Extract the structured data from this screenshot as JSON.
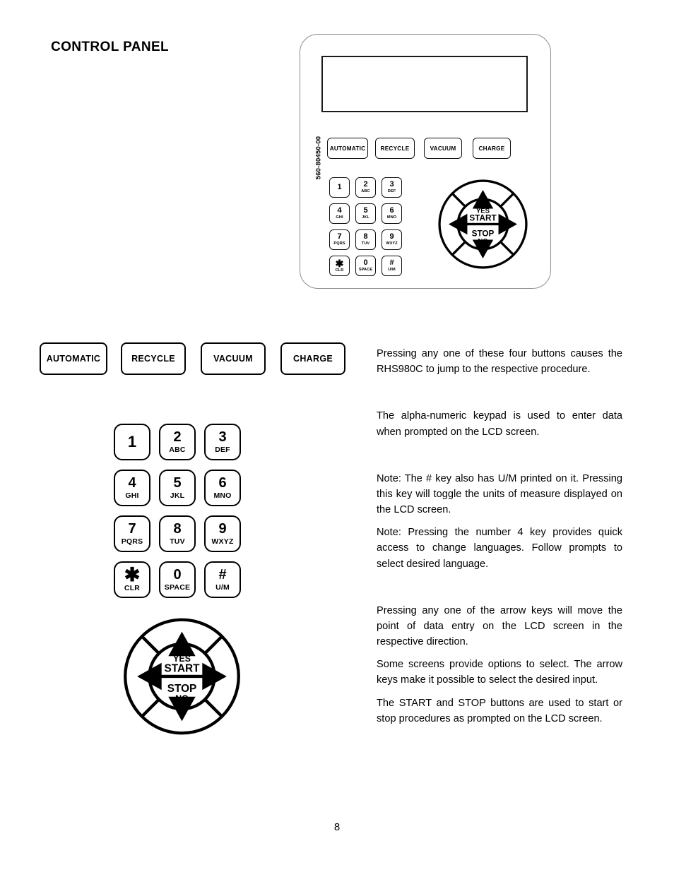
{
  "page": {
    "title": "CONTROL PANEL",
    "number": "8"
  },
  "panel": {
    "part_number": "560-80450-00",
    "lcd_label": "",
    "function_buttons": [
      {
        "label": "AUTOMATIC"
      },
      {
        "label": "RECYCLE"
      },
      {
        "label": "VACUUM"
      },
      {
        "label": "CHARGE"
      }
    ],
    "keypad": [
      {
        "digit": "1",
        "sub": ""
      },
      {
        "digit": "2",
        "sub": "ABC"
      },
      {
        "digit": "3",
        "sub": "DEF"
      },
      {
        "digit": "4",
        "sub": "GHI"
      },
      {
        "digit": "5",
        "sub": "JKL"
      },
      {
        "digit": "6",
        "sub": "MNO"
      },
      {
        "digit": "7",
        "sub": "PQRS"
      },
      {
        "digit": "8",
        "sub": "TUV"
      },
      {
        "digit": "9",
        "sub": "WXYZ"
      },
      {
        "digit": "✱",
        "sub": "CLR"
      },
      {
        "digit": "0",
        "sub": "SPACE"
      },
      {
        "digit": "#",
        "sub": "U/M"
      }
    ],
    "arrow_pad": {
      "yes_label": "YES",
      "start_label": "START",
      "stop_label": "STOP",
      "no_label": "NO",
      "up_icon": "arrow-up-icon",
      "down_icon": "arrow-down-icon",
      "left_icon": "arrow-left-icon",
      "right_icon": "arrow-right-icon"
    }
  },
  "text": {
    "p1": "Pressing any one of these four buttons causes the RHS980C to jump to the respective procedure.",
    "p2": "The alpha-numeric keypad is used to enter data when prompted on the LCD screen.",
    "p3": "Note:  The # key also has U/M printed on it. Pressing this key will toggle the units of measure displayed on the LCD screen.",
    "p4": "Note: Pressing the number 4 key provides quick access to change languages.  Follow prompts to select desired language.",
    "p5": "Pressing any one of the arrow keys will move the point of data entry on the LCD screen in the respective direction.",
    "p6": "Some screens provide options to select. The arrow keys make it possible to select the desired input.",
    "p7": "The START and STOP buttons are used to start or stop procedures as prompted on the LCD screen."
  }
}
